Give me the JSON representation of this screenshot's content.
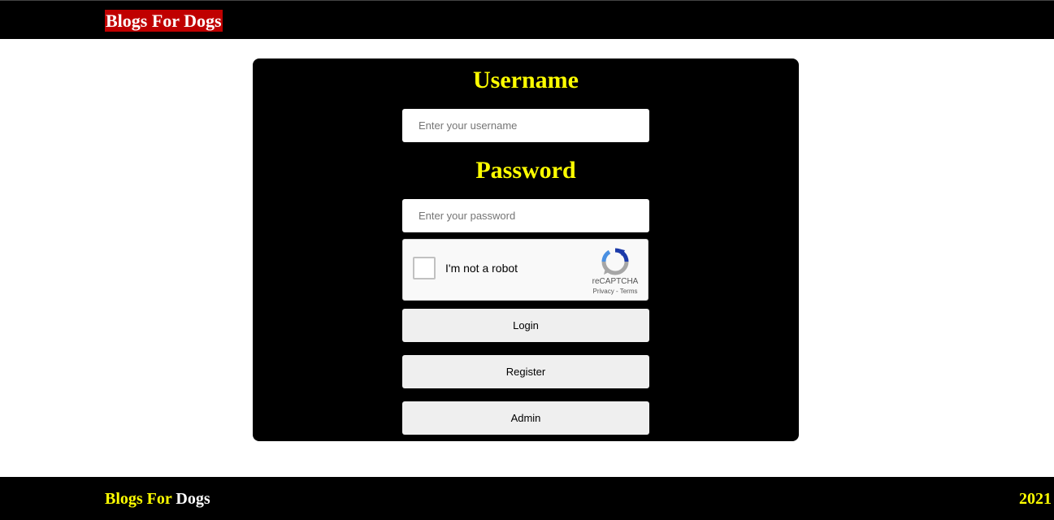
{
  "header": {
    "brand": "Blogs For Dogs"
  },
  "login_form": {
    "username_label": "Username",
    "username_placeholder": "Enter your username",
    "username_value": "",
    "password_label": "Password",
    "password_placeholder": "Enter your password",
    "password_value": "",
    "recaptcha": {
      "checkbox_label": "I'm not a robot",
      "checked": false,
      "brand": "reCAPTCHA",
      "privacy": "Privacy",
      "separator": "-",
      "terms": "Terms"
    },
    "buttons": {
      "login": "Login",
      "register": "Register",
      "admin": "Admin"
    }
  },
  "footer": {
    "brand_part1": "Blogs For",
    "brand_part2": "Dogs",
    "year": "2021"
  },
  "colors": {
    "background": "#ffffff",
    "bar": "#000000",
    "brand_highlight": "#c00000",
    "label_yellow": "#ffff00",
    "button_bg": "#efefef",
    "recaptcha_blue": "#1c3aa9",
    "recaptcha_grey": "#a6a6a6"
  }
}
